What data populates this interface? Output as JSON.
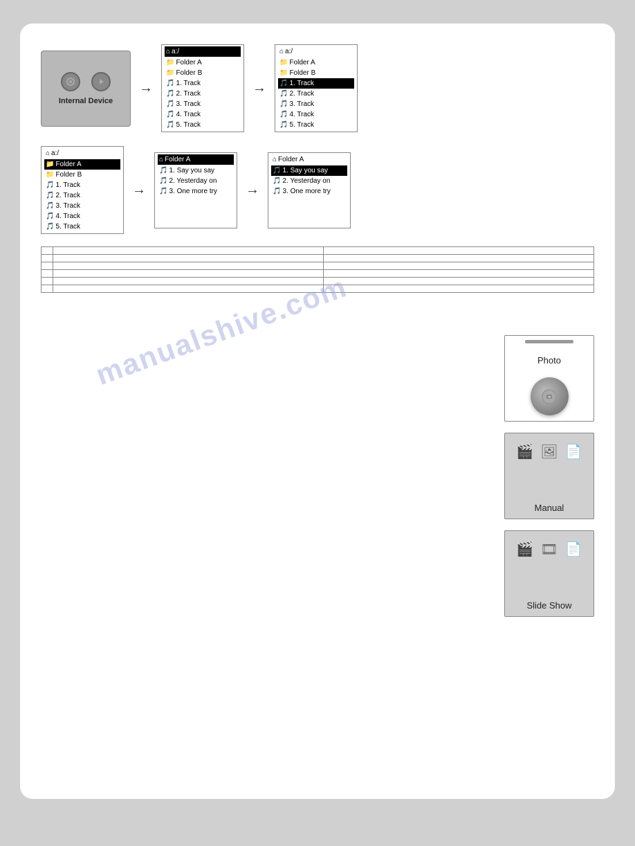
{
  "page": {
    "bg_color": "#d0d0d0",
    "card_bg": "#ffffff"
  },
  "watermark": {
    "text": "manualshive.com"
  },
  "diagram": {
    "row1": {
      "device": {
        "label": "Internal Device"
      },
      "box1": {
        "header": "a:/",
        "header_selected": true,
        "items": [
          {
            "icon": "folder",
            "text": "Folder A",
            "selected": false
          },
          {
            "icon": "folder",
            "text": "Folder B",
            "selected": false
          },
          {
            "icon": "music",
            "text": "1. Track",
            "selected": false
          },
          {
            "icon": "music",
            "text": "2. Track",
            "selected": false
          },
          {
            "icon": "music",
            "text": "3. Track",
            "selected": false
          },
          {
            "icon": "music",
            "text": "4. Track",
            "selected": false
          },
          {
            "icon": "music",
            "text": "5. Track",
            "selected": false
          }
        ]
      },
      "box2": {
        "header": "a:/",
        "header_selected": false,
        "items": [
          {
            "icon": "folder",
            "text": "Folder A",
            "selected": false
          },
          {
            "icon": "folder",
            "text": "Folder B",
            "selected": false
          },
          {
            "icon": "music",
            "text": "1. Track",
            "selected": true
          },
          {
            "icon": "music",
            "text": "2. Track",
            "selected": false
          },
          {
            "icon": "music",
            "text": "3. Track",
            "selected": false
          },
          {
            "icon": "music",
            "text": "4. Track",
            "selected": false
          },
          {
            "icon": "music",
            "text": "5. Track",
            "selected": false
          }
        ]
      }
    },
    "row2": {
      "box1": {
        "header": "a:/",
        "header_selected": false,
        "items": [
          {
            "icon": "folder",
            "text": "Folder A",
            "selected": true
          },
          {
            "icon": "folder",
            "text": "Folder B",
            "selected": false
          },
          {
            "icon": "music",
            "text": "1. Track",
            "selected": false
          },
          {
            "icon": "music",
            "text": "2. Track",
            "selected": false
          },
          {
            "icon": "music",
            "text": "3. Track",
            "selected": false
          },
          {
            "icon": "music",
            "text": "4. Track",
            "selected": false
          },
          {
            "icon": "music",
            "text": "5. Track",
            "selected": false
          }
        ]
      },
      "box2": {
        "header": "Folder A",
        "header_selected": true,
        "items": [
          {
            "icon": "music",
            "text": "1. Say you say",
            "selected": false
          },
          {
            "icon": "music",
            "text": "2. Yesterday on",
            "selected": false
          },
          {
            "icon": "music",
            "text": "3. One more try",
            "selected": false
          }
        ]
      },
      "box3": {
        "header": "Folder A",
        "header_selected": false,
        "items": [
          {
            "icon": "music",
            "text": "1. Say you say",
            "selected": true
          },
          {
            "icon": "music",
            "text": "2. Yesterday on",
            "selected": false
          },
          {
            "icon": "music",
            "text": "3. One more try",
            "selected": false
          }
        ]
      }
    }
  },
  "table": {
    "rows": [
      {
        "label": "",
        "col1": "",
        "col2": ""
      },
      {
        "label": "",
        "col1": "",
        "col2": ""
      },
      {
        "label": "",
        "col1": "",
        "col2": ""
      },
      {
        "label": "",
        "col1": "",
        "col2": ""
      },
      {
        "label": "",
        "col1": "",
        "col2": ""
      },
      {
        "label": "",
        "col1": "",
        "col2": ""
      }
    ]
  },
  "panels": [
    {
      "id": "photo",
      "label": "Photo",
      "type": "photo"
    },
    {
      "id": "manual",
      "label": "Manual",
      "type": "icons"
    },
    {
      "id": "slideshow",
      "label": "Slide Show",
      "type": "icons"
    }
  ]
}
